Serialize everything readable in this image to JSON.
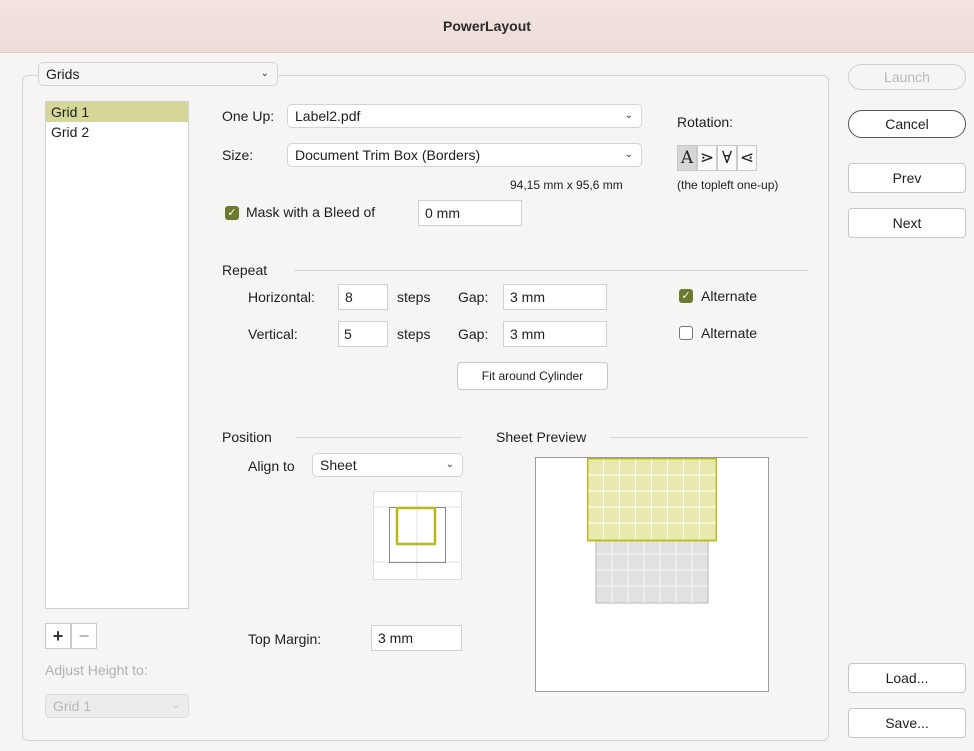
{
  "window": {
    "title": "PowerLayout"
  },
  "mode_select": {
    "value": "Grids"
  },
  "grid_list": {
    "items": [
      "Grid 1",
      "Grid 2"
    ],
    "selected": "Grid 1"
  },
  "one_up": {
    "label": "One Up:",
    "value": "Label2.pdf"
  },
  "size": {
    "label": "Size:",
    "value": "Document Trim Box (Borders)",
    "dimensions": "94,15 mm x 95,6 mm"
  },
  "rotation": {
    "label": "Rotation:",
    "glyphs": [
      "A",
      "⋗",
      "∀",
      "⋖"
    ],
    "note": "(the topleft one-up)"
  },
  "mask": {
    "label": "Mask with a Bleed of",
    "value": "0 mm",
    "checked": true
  },
  "repeat": {
    "title": "Repeat",
    "horizontal": {
      "label": "Horizontal:",
      "value": "8",
      "steps": "steps",
      "gap_label": "Gap:",
      "gap": "3 mm",
      "alt_label": "Alternate",
      "alt_checked": true
    },
    "vertical": {
      "label": "Vertical:",
      "value": "5",
      "steps": "steps",
      "gap_label": "Gap:",
      "gap": "3 mm",
      "alt_label": "Alternate",
      "alt_checked": false
    },
    "fit_button": "Fit around Cylinder"
  },
  "position": {
    "title": "Position",
    "align_label": "Align to",
    "align_value": "Sheet",
    "top_margin_label": "Top Margin:",
    "top_margin_value": "3 mm"
  },
  "preview": {
    "title": "Sheet Preview"
  },
  "list_controls": {
    "add": "+",
    "remove": "−"
  },
  "adjust": {
    "label": "Adjust Height to:",
    "value": "Grid 1"
  },
  "buttons": {
    "launch": "Launch",
    "cancel": "Cancel",
    "prev": "Prev",
    "next": "Next",
    "load": "Load...",
    "save": "Save..."
  },
  "colors": {
    "accent": "#c8c94a",
    "selection": "#d4d797",
    "check": "#6b7b2e"
  }
}
